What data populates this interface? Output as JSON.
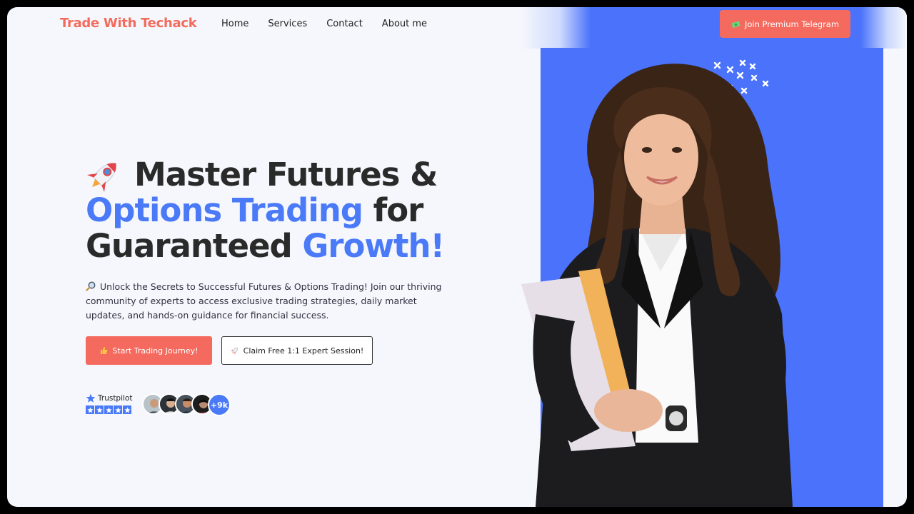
{
  "brand": {
    "logo": "Trade With Techack",
    "accent": "#f56a5e",
    "blue": "#4a7af7"
  },
  "nav": {
    "items": [
      "Home",
      "Services",
      "Contact",
      "About me"
    ]
  },
  "header": {
    "cta_icon": "money-icon",
    "cta_label": "Join Premium Telegram"
  },
  "hero": {
    "line1": "Master Futures &",
    "line2_blue": "Options Trading",
    "line2_rest": " for",
    "line3_rest": "Guaranteed ",
    "line3_blue": "Growth!",
    "description": "Unlock the Secrets to Successful Futures & Options Trading! Join our thriving community of experts to access exclusive trading strategies, daily market updates, and hands-on guidance for financial success.",
    "primary_button": "Start Trading Journey!",
    "secondary_button": "Claim Free 1:1 Expert Session!"
  },
  "trust": {
    "label": "Trustpilot",
    "stars": 5,
    "more_count": "+9k"
  }
}
